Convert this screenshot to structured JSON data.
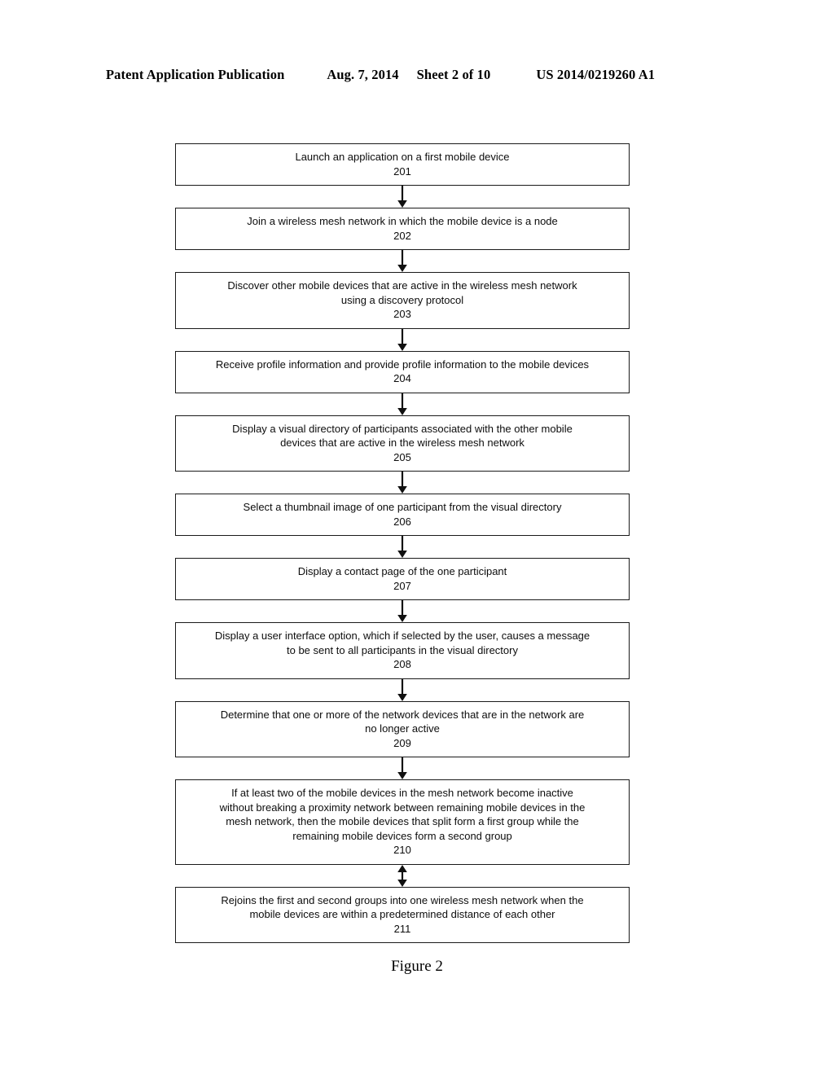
{
  "header": {
    "publication": "Patent Application Publication",
    "date": "Aug. 7, 2014",
    "sheet": "Sheet 2 of 10",
    "patent_number": "US 2014/0219260 A1"
  },
  "figure": {
    "caption": "Figure 2"
  },
  "flowchart": {
    "boxes": [
      {
        "text": "Launch an application on a first mobile device",
        "number": "201"
      },
      {
        "text": "Join a wireless mesh network in which the mobile device is a node",
        "number": "202"
      },
      {
        "text": "Discover other mobile devices that are active in the wireless mesh network\nusing a discovery protocol",
        "number": "203"
      },
      {
        "text": "Receive profile information and provide profile information to the mobile devices",
        "number": "204"
      },
      {
        "text": "Display a visual directory of participants associated with the other mobile\ndevices that are active in the wireless mesh network",
        "number": "205"
      },
      {
        "text": "Select a thumbnail image of one participant from the visual directory",
        "number": "206"
      },
      {
        "text": "Display a contact page of the one participant",
        "number": "207"
      },
      {
        "text": "Display a user interface option, which if selected by the user, causes a message\nto be sent to all participants in the visual directory",
        "number": "208"
      },
      {
        "text": "Determine that one or more of the network devices that are in the network are\nno longer active",
        "number": "209"
      },
      {
        "text": "If at least two of the mobile devices in the mesh network become inactive\nwithout breaking a proximity network between remaining mobile devices in the\nmesh network, then the mobile devices that split form a first group while the\nremaining mobile devices form a second group",
        "number": "210"
      },
      {
        "text": "Rejoins the first and second groups into one wireless mesh network when the\nmobile devices are within a predetermined distance of each other",
        "number": "211"
      }
    ],
    "connectors": [
      {
        "from": "201",
        "to": "202",
        "direction": "down"
      },
      {
        "from": "202",
        "to": "203",
        "direction": "down"
      },
      {
        "from": "203",
        "to": "204",
        "direction": "down"
      },
      {
        "from": "204",
        "to": "205",
        "direction": "down"
      },
      {
        "from": "205",
        "to": "206",
        "direction": "down"
      },
      {
        "from": "206",
        "to": "207",
        "direction": "down"
      },
      {
        "from": "207",
        "to": "208",
        "direction": "down"
      },
      {
        "from": "208",
        "to": "209",
        "direction": "down"
      },
      {
        "from": "209",
        "to": "210",
        "direction": "down"
      },
      {
        "from": "210",
        "to": "211",
        "direction": "bidirectional"
      }
    ]
  }
}
